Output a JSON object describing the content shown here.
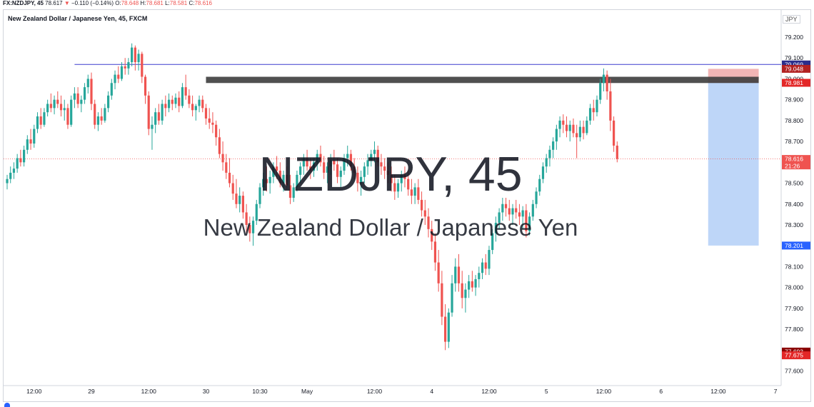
{
  "header": {
    "symbol": "FX:NZDJPY, 45",
    "last": "78.617",
    "arrow": "▼",
    "change": "−0.110 (−0.14%)",
    "o_label": "O:",
    "o": "78.648",
    "h_label": "H:",
    "h": "78.681",
    "l_label": "L:",
    "l": "78.581",
    "c_label": "C:",
    "c": "78.616"
  },
  "chart_title": "New Zealand Dollar / Japanese Yen, 45, FXCM",
  "currency": "JPY",
  "watermark": {
    "big": "NZDJPY, 45",
    "sub": "New Zealand Dollar / Japanese Yen"
  },
  "colors": {
    "up": "#26a69a",
    "down": "#ef5350",
    "resistance": "#3d3d3d",
    "stop_zone": "#f0a8a8",
    "target_zone": "#a8c8f5",
    "hline": "#3d3dcf"
  },
  "chart_data": {
    "type": "candlestick",
    "ylim": [
      77.53,
      79.33
    ],
    "y_ticks": [
      "79.200",
      "79.100",
      "79.000",
      "78.900",
      "78.800",
      "78.700",
      "78.600",
      "78.500",
      "78.400",
      "78.300",
      "78.200",
      "78.100",
      "78.000",
      "77.900",
      "77.800",
      "77.700",
      "77.600"
    ],
    "x_ticks": [
      {
        "label": "12:00",
        "i": 8
      },
      {
        "label": "29",
        "i": 25
      },
      {
        "label": "12:00",
        "i": 42
      },
      {
        "label": "30",
        "i": 59
      },
      {
        "label": "10:30",
        "i": 75
      },
      {
        "label": "May",
        "i": 89
      },
      {
        "label": "12:00",
        "i": 109
      },
      {
        "label": "4",
        "i": 126
      },
      {
        "label": "12:00",
        "i": 143
      },
      {
        "label": "5",
        "i": 160
      },
      {
        "label": "12:00",
        "i": 177
      },
      {
        "label": "6",
        "i": 194
      },
      {
        "label": "12:00",
        "i": 211
      },
      {
        "label": "7",
        "i": 228
      }
    ],
    "candles": [
      [
        78.5,
        78.54,
        78.47,
        78.52
      ],
      [
        78.52,
        78.58,
        78.5,
        78.55
      ],
      [
        78.55,
        78.6,
        78.52,
        78.57
      ],
      [
        78.57,
        78.64,
        78.55,
        78.62
      ],
      [
        78.62,
        78.66,
        78.58,
        78.6
      ],
      [
        78.6,
        78.68,
        78.58,
        78.66
      ],
      [
        78.66,
        78.73,
        78.64,
        78.71
      ],
      [
        78.71,
        78.76,
        78.66,
        78.69
      ],
      [
        78.69,
        78.78,
        78.67,
        78.76
      ],
      [
        78.76,
        78.84,
        78.74,
        78.82
      ],
      [
        78.82,
        78.86,
        78.76,
        78.78
      ],
      [
        78.78,
        78.86,
        78.77,
        78.84
      ],
      [
        78.84,
        78.9,
        78.82,
        78.88
      ],
      [
        78.88,
        78.93,
        78.84,
        78.86
      ],
      [
        78.86,
        78.92,
        78.83,
        78.9
      ],
      [
        78.9,
        78.94,
        78.86,
        78.88
      ],
      [
        78.88,
        78.92,
        78.82,
        78.85
      ],
      [
        78.85,
        78.9,
        78.8,
        78.86
      ],
      [
        78.86,
        78.88,
        78.76,
        78.78
      ],
      [
        78.78,
        78.92,
        78.77,
        78.9
      ],
      [
        78.9,
        78.96,
        78.86,
        78.93
      ],
      [
        78.93,
        78.96,
        78.86,
        78.88
      ],
      [
        78.88,
        78.92,
        78.84,
        78.9
      ],
      [
        78.9,
        78.98,
        78.88,
        78.96
      ],
      [
        78.96,
        79.02,
        78.93,
        79.0
      ],
      [
        79.0,
        79.03,
        78.85,
        78.88
      ],
      [
        78.88,
        78.9,
        78.76,
        78.78
      ],
      [
        78.78,
        78.84,
        78.75,
        78.82
      ],
      [
        78.82,
        78.86,
        78.78,
        78.8
      ],
      [
        78.8,
        78.88,
        78.79,
        78.86
      ],
      [
        78.86,
        78.94,
        78.84,
        78.92
      ],
      [
        78.92,
        79.0,
        78.9,
        78.98
      ],
      [
        78.98,
        79.04,
        78.95,
        79.02
      ],
      [
        79.02,
        79.06,
        78.98,
        79.0
      ],
      [
        79.0,
        79.08,
        78.99,
        79.06
      ],
      [
        79.06,
        79.1,
        79.02,
        79.05
      ],
      [
        79.05,
        79.1,
        79.02,
        79.08
      ],
      [
        79.08,
        79.17,
        79.06,
        79.15
      ],
      [
        79.15,
        79.16,
        79.04,
        79.08
      ],
      [
        79.08,
        79.14,
        79.04,
        79.12
      ],
      [
        79.12,
        79.13,
        78.98,
        79.01
      ],
      [
        79.01,
        79.02,
        78.88,
        78.92
      ],
      [
        78.92,
        78.94,
        78.73,
        78.76
      ],
      [
        78.76,
        78.82,
        78.66,
        78.78
      ],
      [
        78.78,
        78.86,
        78.74,
        78.84
      ],
      [
        78.84,
        78.88,
        78.78,
        78.8
      ],
      [
        78.8,
        78.9,
        78.78,
        78.88
      ],
      [
        78.88,
        78.92,
        78.82,
        78.86
      ],
      [
        78.86,
        78.93,
        78.84,
        78.9
      ],
      [
        78.9,
        78.92,
        78.85,
        78.88
      ],
      [
        78.88,
        78.93,
        78.86,
        78.91
      ],
      [
        78.91,
        78.94,
        78.84,
        78.87
      ],
      [
        78.87,
        78.98,
        78.86,
        78.96
      ],
      [
        78.96,
        79.02,
        78.9,
        78.92
      ],
      [
        78.92,
        78.95,
        78.86,
        78.88
      ],
      [
        78.88,
        78.92,
        78.82,
        78.85
      ],
      [
        78.85,
        78.88,
        78.8,
        78.87
      ],
      [
        78.87,
        78.92,
        78.84,
        78.9
      ],
      [
        78.9,
        78.92,
        78.84,
        78.86
      ],
      [
        78.86,
        78.88,
        78.78,
        78.81
      ],
      [
        78.81,
        78.86,
        78.76,
        78.79
      ],
      [
        78.79,
        78.84,
        78.74,
        78.78
      ],
      [
        78.78,
        78.8,
        78.68,
        78.72
      ],
      [
        78.72,
        78.76,
        78.62,
        78.64
      ],
      [
        78.64,
        78.7,
        78.56,
        78.6
      ],
      [
        78.6,
        78.64,
        78.52,
        78.55
      ],
      [
        78.55,
        78.62,
        78.48,
        78.5
      ],
      [
        78.5,
        78.54,
        78.42,
        78.45
      ],
      [
        78.45,
        78.52,
        78.38,
        78.4
      ],
      [
        78.4,
        78.48,
        78.36,
        78.44
      ],
      [
        78.44,
        78.46,
        78.33,
        78.36
      ],
      [
        78.36,
        78.4,
        78.26,
        78.3
      ],
      [
        78.3,
        78.34,
        78.22,
        78.26
      ],
      [
        78.26,
        78.34,
        78.2,
        78.32
      ],
      [
        78.32,
        78.42,
        78.3,
        78.4
      ],
      [
        78.4,
        78.5,
        78.38,
        78.48
      ],
      [
        78.48,
        78.55,
        78.44,
        78.52
      ],
      [
        78.52,
        78.58,
        78.46,
        78.5
      ],
      [
        78.5,
        78.56,
        78.45,
        78.53
      ],
      [
        78.53,
        78.6,
        78.5,
        78.58
      ],
      [
        78.58,
        78.63,
        78.52,
        78.56
      ],
      [
        78.56,
        78.6,
        78.48,
        78.5
      ],
      [
        78.5,
        78.56,
        78.46,
        78.54
      ],
      [
        78.54,
        78.58,
        78.47,
        78.49
      ],
      [
        78.49,
        78.54,
        78.4,
        78.43
      ],
      [
        78.43,
        78.5,
        78.41,
        78.48
      ],
      [
        78.48,
        78.56,
        78.46,
        78.54
      ],
      [
        78.54,
        78.6,
        78.5,
        78.58
      ],
      [
        78.58,
        78.64,
        78.54,
        78.62
      ],
      [
        78.62,
        78.66,
        78.56,
        78.58
      ],
      [
        78.58,
        78.62,
        78.52,
        78.56
      ],
      [
        78.56,
        78.62,
        78.53,
        78.6
      ],
      [
        78.6,
        78.66,
        78.56,
        78.64
      ],
      [
        78.64,
        78.68,
        78.58,
        78.6
      ],
      [
        78.6,
        78.63,
        78.52,
        78.55
      ],
      [
        78.55,
        78.6,
        78.5,
        78.58
      ],
      [
        78.58,
        78.64,
        78.54,
        78.61
      ],
      [
        78.61,
        78.66,
        78.56,
        78.59
      ],
      [
        78.59,
        78.62,
        78.5,
        78.53
      ],
      [
        78.53,
        78.58,
        78.48,
        78.56
      ],
      [
        78.56,
        78.64,
        78.54,
        78.62
      ],
      [
        78.62,
        78.68,
        78.58,
        78.64
      ],
      [
        78.64,
        78.66,
        78.56,
        78.58
      ],
      [
        78.58,
        78.62,
        78.52,
        78.55
      ],
      [
        78.55,
        78.58,
        78.46,
        78.5
      ],
      [
        78.5,
        78.56,
        78.44,
        78.53
      ],
      [
        78.53,
        78.6,
        78.5,
        78.58
      ],
      [
        78.58,
        78.64,
        78.54,
        78.61
      ],
      [
        78.61,
        78.66,
        78.58,
        78.64
      ],
      [
        78.64,
        78.7,
        78.6,
        78.66
      ],
      [
        78.66,
        78.68,
        78.58,
        78.6
      ],
      [
        78.6,
        78.64,
        78.54,
        78.58
      ],
      [
        78.58,
        78.62,
        78.52,
        78.56
      ],
      [
        78.56,
        78.6,
        78.5,
        78.54
      ],
      [
        78.54,
        78.58,
        78.46,
        78.5
      ],
      [
        78.5,
        78.54,
        78.42,
        78.46
      ],
      [
        78.46,
        78.52,
        78.43,
        78.5
      ],
      [
        78.5,
        78.56,
        78.46,
        78.54
      ],
      [
        78.54,
        78.58,
        78.48,
        78.52
      ],
      [
        78.52,
        78.56,
        78.44,
        78.47
      ],
      [
        78.47,
        78.52,
        78.4,
        78.44
      ],
      [
        78.44,
        78.5,
        78.4,
        78.48
      ],
      [
        78.48,
        78.52,
        78.4,
        78.42
      ],
      [
        78.42,
        78.46,
        78.34,
        78.37
      ],
      [
        78.37,
        78.42,
        78.3,
        78.34
      ],
      [
        78.34,
        78.38,
        78.24,
        78.28
      ],
      [
        78.28,
        78.32,
        78.18,
        78.22
      ],
      [
        78.22,
        78.26,
        78.08,
        78.12
      ],
      [
        78.12,
        78.18,
        77.98,
        78.02
      ],
      [
        78.02,
        78.08,
        77.82,
        77.86
      ],
      [
        77.86,
        77.92,
        77.7,
        77.74
      ],
      [
        77.74,
        77.9,
        77.71,
        77.88
      ],
      [
        77.88,
        78.06,
        77.86,
        78.02
      ],
      [
        78.02,
        78.14,
        77.98,
        78.1
      ],
      [
        78.1,
        78.16,
        77.98,
        78.02
      ],
      [
        78.02,
        78.08,
        77.9,
        77.95
      ],
      [
        77.95,
        78.02,
        77.88,
        77.99
      ],
      [
        77.99,
        78.06,
        77.95,
        78.03
      ],
      [
        78.03,
        78.08,
        77.98,
        78.0
      ],
      [
        78.0,
        78.06,
        77.96,
        78.04
      ],
      [
        78.04,
        78.1,
        78.0,
        78.07
      ],
      [
        78.07,
        78.14,
        78.04,
        78.12
      ],
      [
        78.12,
        78.16,
        78.06,
        78.09
      ],
      [
        78.09,
        78.2,
        78.06,
        78.18
      ],
      [
        78.18,
        78.28,
        78.16,
        78.26
      ],
      [
        78.26,
        78.34,
        78.22,
        78.31
      ],
      [
        78.31,
        78.38,
        78.28,
        78.36
      ],
      [
        78.36,
        78.43,
        78.32,
        78.4
      ],
      [
        78.4,
        78.43,
        78.34,
        78.38
      ],
      [
        78.38,
        78.42,
        78.32,
        78.35
      ],
      [
        78.35,
        78.4,
        78.3,
        78.38
      ],
      [
        78.38,
        78.42,
        78.33,
        78.36
      ],
      [
        78.36,
        78.4,
        78.3,
        78.34
      ],
      [
        78.34,
        78.39,
        78.28,
        78.37
      ],
      [
        78.37,
        78.4,
        78.24,
        78.27
      ],
      [
        78.27,
        78.36,
        78.25,
        78.34
      ],
      [
        78.34,
        78.42,
        78.32,
        78.4
      ],
      [
        78.4,
        78.48,
        78.38,
        78.46
      ],
      [
        78.46,
        78.54,
        78.44,
        78.52
      ],
      [
        78.52,
        78.6,
        78.5,
        78.58
      ],
      [
        78.58,
        78.64,
        78.55,
        78.62
      ],
      [
        78.62,
        78.68,
        78.58,
        78.66
      ],
      [
        78.66,
        78.72,
        78.62,
        78.7
      ],
      [
        78.7,
        78.78,
        78.66,
        78.76
      ],
      [
        78.76,
        78.82,
        78.72,
        78.8
      ],
      [
        78.8,
        78.83,
        78.74,
        78.78
      ],
      [
        78.78,
        78.82,
        78.72,
        78.75
      ],
      [
        78.75,
        78.8,
        78.7,
        78.78
      ],
      [
        78.78,
        78.81,
        78.72,
        78.74
      ],
      [
        78.74,
        78.78,
        78.62,
        78.72
      ],
      [
        78.72,
        78.8,
        78.7,
        78.77
      ],
      [
        78.77,
        78.8,
        78.71,
        78.74
      ],
      [
        78.74,
        78.82,
        78.73,
        78.8
      ],
      [
        78.8,
        78.88,
        78.78,
        78.86
      ],
      [
        78.86,
        78.9,
        78.8,
        78.84
      ],
      [
        78.84,
        78.92,
        78.82,
        78.9
      ],
      [
        78.9,
        79.0,
        78.88,
        78.98
      ],
      [
        78.98,
        79.05,
        78.94,
        79.02
      ],
      [
        79.02,
        79.04,
        78.9,
        78.94
      ],
      [
        78.94,
        79.0,
        78.75,
        78.8
      ],
      [
        78.8,
        78.82,
        78.65,
        78.68
      ],
      [
        78.68,
        78.7,
        78.6,
        78.616
      ]
    ],
    "levels": [
      {
        "price": 79.069,
        "label": "79.069",
        "bg": "#2a2e8c"
      },
      {
        "price": 79.048,
        "label": "79.048",
        "bg": "#b22222"
      },
      {
        "price": 78.981,
        "label": "78.981",
        "bg": "#e32727"
      },
      {
        "price": 78.616,
        "label": "78.616",
        "bg": "#ef5350",
        "sub": "21:26"
      },
      {
        "price": 78.201,
        "label": "78.201",
        "bg": "#2962ff"
      },
      {
        "price": 77.693,
        "label": "77.693",
        "bg": "#8b0000"
      },
      {
        "price": 77.675,
        "label": "77.675",
        "bg": "#e32727"
      }
    ],
    "resistance": {
      "from_i": 59,
      "to_i": 223,
      "top": 79.01,
      "bottom": 78.98
    },
    "position": {
      "from_i": 208,
      "to_i": 223,
      "entry": 78.981,
      "stop": 79.048,
      "target": 78.201
    },
    "hline": 79.069
  }
}
